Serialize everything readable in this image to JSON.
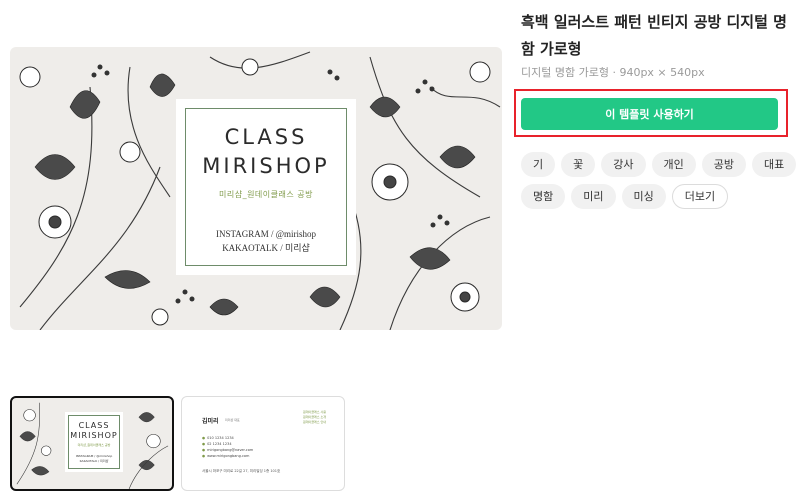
{
  "product": {
    "title": "흑백 일러스트 패턴 빈티지 공방 디지털 명함 가로형",
    "meta": "디지털 명함 가로형 · 940px × 540px",
    "use_button_label": "이 템플릿 사용하기"
  },
  "preview": {
    "brand_line1": "CLASS",
    "brand_line2": "MIRISHOP",
    "brand_subtitle": "미리샵_원데이클래스 공방",
    "contact_line1": "INSTAGRAM / @mirishop",
    "contact_line2": "KAKAOTALK / 미리샵"
  },
  "tags": {
    "row1": [
      "기",
      "꽃",
      "강사",
      "개인",
      "공방",
      "대표"
    ],
    "row2": [
      "명함",
      "미리",
      "미싱"
    ],
    "more_label": "더보기"
  },
  "thumbnails": {
    "front": {
      "brand_line1": "CLASS",
      "brand_line2": "MIRISHOP",
      "subtitle": "미리샵_원데이클래스 공방",
      "contact_line1": "INSTAGRAM / @mirishop",
      "contact_line2": "KAKAOTALK / 미리샵"
    },
    "back": {
      "name": "김미리",
      "role": "미리샵 대표",
      "green_lines": [
        "원데이클래스 사용",
        "원데이클래스 소개",
        "원데이클래스 안내"
      ],
      "info_lines": [
        "010 1234 1234",
        "02 1234 1234",
        "mirigongbang@naver.com",
        "www.mirigongbang.com"
      ],
      "address": "서울시 마포구 미리로 22길 27, 미리빌딩 1층 101호"
    }
  },
  "colors": {
    "accent_green": "#22c886",
    "highlight_red": "#e8222b",
    "brand_olive": "#7f9a49"
  }
}
